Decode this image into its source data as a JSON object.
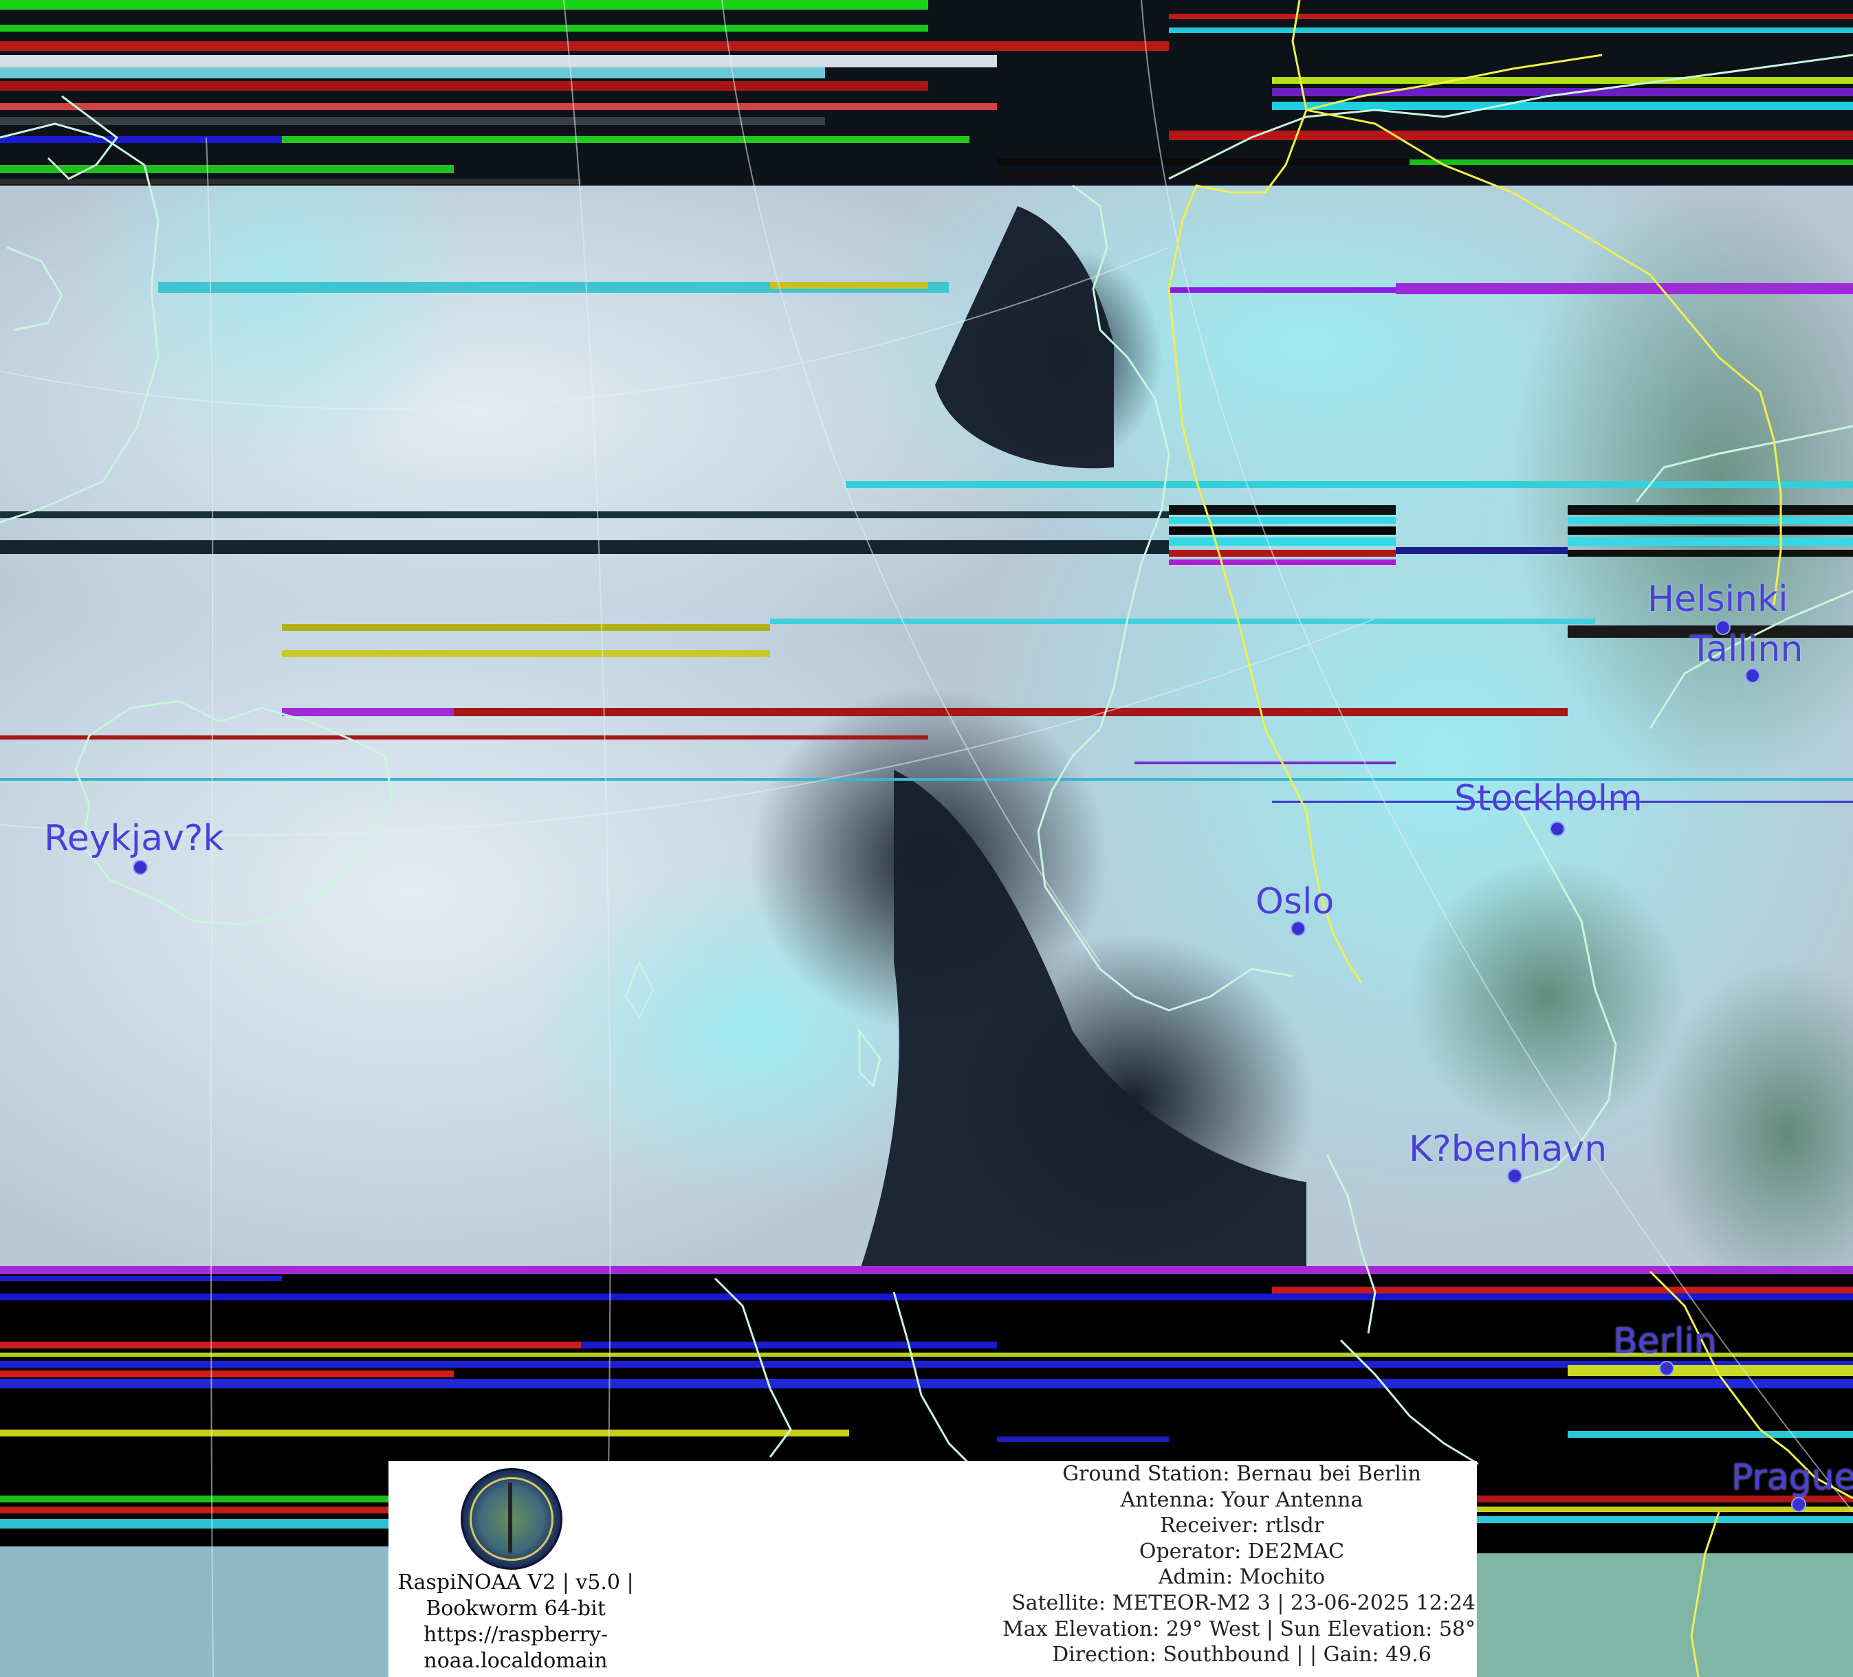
{
  "cities": [
    {
      "key": "helsinki",
      "name": "Helsinki"
    },
    {
      "key": "tallinn",
      "name": "Tallinn"
    },
    {
      "key": "stockholm",
      "name": "Stockholm"
    },
    {
      "key": "reykjavik",
      "name": "Reykjav?k"
    },
    {
      "key": "oslo",
      "name": "Oslo"
    },
    {
      "key": "kobenhavn",
      "name": "K?benhavn"
    },
    {
      "key": "berlin",
      "name": "Berlin"
    },
    {
      "key": "prague",
      "name": "Prague"
    }
  ],
  "info": {
    "software": [
      "RaspiNOAA V2 | v5.0 |",
      "Bookworm 64-bit",
      "https://raspberry-",
      "noaa.localdomain"
    ],
    "ground_station": "Ground Station: Bernau bei Berlin",
    "antenna": "Antenna: Your Antenna",
    "receiver": "Receiver: rtlsdr",
    "operator": "Operator: DE2MAC",
    "admin": "Admin: Mochito",
    "satellite": "Satellite: METEOR-M2 3 | 23-06-2025 12:24",
    "elevation": "Max Elevation: 29° West | Sun Elevation: 58°",
    "direction": "Direction: Southbound | | Gain: 49.6"
  },
  "colors": {
    "city_label": "#4b3fd8",
    "coastline": "#c8f5df",
    "border": "#f0f04a",
    "cloud": "#d8e4ec",
    "cloud_cyan": "#8ee6ee",
    "sea": "#1d2530"
  }
}
